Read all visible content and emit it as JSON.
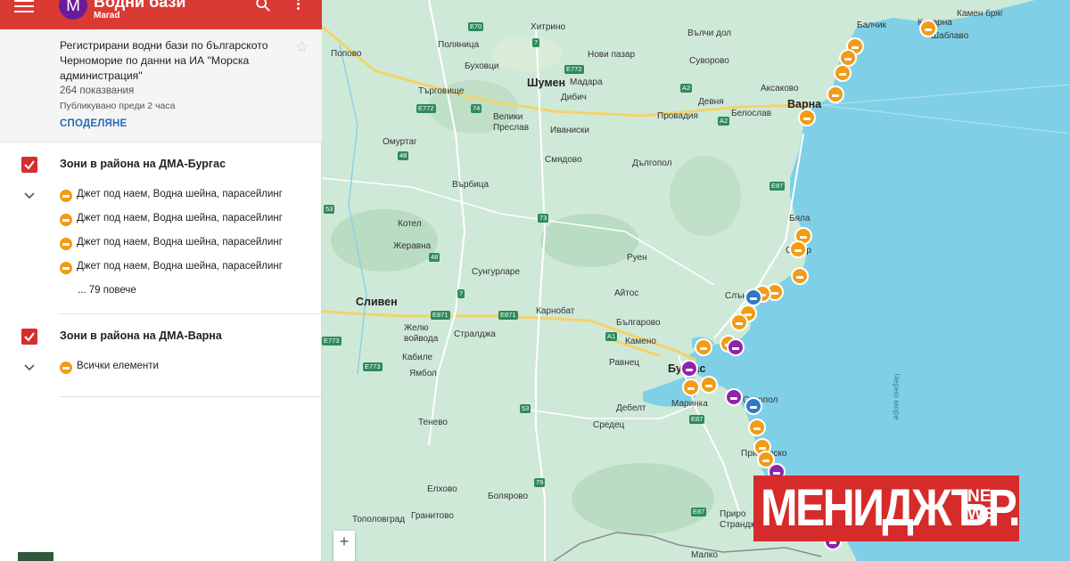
{
  "app": {
    "title": "Водни бази",
    "owner": "Marad",
    "avatar_letter": "M"
  },
  "info": {
    "description": "Регистрирани водни бази по българското Черноморие по данни на ИА \"Морска администрация\"",
    "views": "264 показвания",
    "published": "Публикувано преди 2 часа",
    "share_label": "СПОДЕЛЯНЕ"
  },
  "layers": [
    {
      "title": "Зони в района на ДМА-Бургас",
      "items": [
        "Джет под наем, Водна шейна, парасейлинг",
        "Джет под наем, Водна шейна, парасейлинг",
        "Джет под наем, Водна шейна, парасейлинг",
        "Джет под наем, Водна шейна, парасейлинг"
      ],
      "more": "... 79 повече"
    },
    {
      "title": "Зони в района на ДМА-Варна",
      "items": [
        "Всички елементи"
      ]
    }
  ],
  "map": {
    "zoom_in_label": "+",
    "cities_major": [
      "Шумен",
      "Варна",
      "Сливен",
      "Бургас"
    ],
    "places": [
      "Хитрино",
      "Вълчи дол",
      "Балчик",
      "Каварна",
      "Камен бряг",
      "Попово",
      "Поляница",
      "Нови пазар",
      "Суворово",
      "Шаблаво",
      "Буховци",
      "Мадара",
      "Аксаково",
      "Търговище",
      "Дибич",
      "Девня",
      "Белослав",
      "Велики Преслав",
      "Иваниски",
      "Провадия",
      "Омуртаг",
      "Смядово",
      "Дългопол",
      "Върбица",
      "Котел",
      "Жеравна",
      "Руен",
      "Сунгурларе",
      "Айтос",
      "Карнобат",
      "Българово",
      "Желю войвода",
      "Стралджа",
      "Камено",
      "Кабиле",
      "Равнец",
      "Ямбол",
      "Дебелт",
      "Маринка",
      "Тенево",
      "Средец",
      "Елхово",
      "Болярово",
      "Тополовград",
      "Гранитово",
      "Слънчев бряг",
      "Обзор",
      "Бяла",
      "Созопол",
      "Приморско",
      "Приро Странджа",
      "Малко"
    ],
    "sea_label": "Черно море",
    "road_labels": [
      "E70",
      "7",
      "E772",
      "74",
      "A2",
      "A2",
      "E772",
      "48",
      "E87",
      "53",
      "73",
      "48",
      "7",
      "E871",
      "E871",
      "A1",
      "E773",
      "E773",
      "53",
      "79",
      "E87",
      "E87"
    ],
    "colors": {
      "land": "#cfe9d8",
      "sea": "#7fd0e6",
      "marker_orange": "#f29b16",
      "marker_purple": "#8e24aa",
      "marker_blue": "#2d7ac4"
    }
  },
  "watermark": {
    "main": "МЕНИДЖЪР.",
    "sub_1": "NE",
    "sub_2": "WS"
  }
}
